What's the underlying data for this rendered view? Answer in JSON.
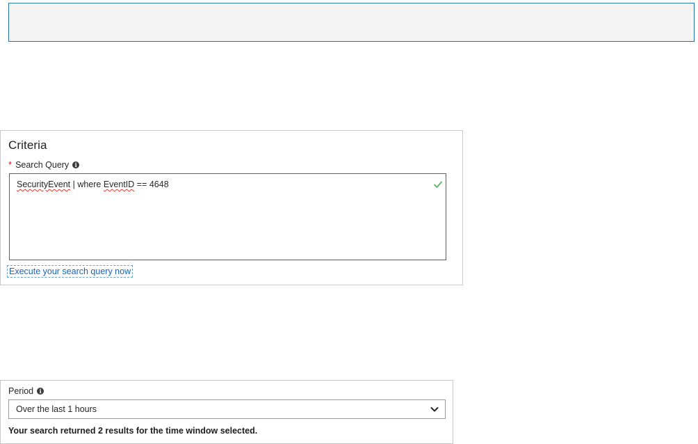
{
  "criteria": {
    "title": "Criteria",
    "query_label": "Search Query",
    "required_marker": "*",
    "query_parts": {
      "word1": "SecurityEvent",
      "middle": " | where ",
      "word2": "EventID",
      "tail": " == 4648"
    },
    "execute_link": "Execute your search query now"
  },
  "period": {
    "label": "Period",
    "selected_value": "Over the last 1 hours",
    "result_message": "Your search returned 2 results for the time window selected."
  },
  "icons": {
    "info": "info-icon",
    "valid": "checkmark-icon",
    "dropdown": "chevron-down-icon"
  },
  "colors": {
    "required_star": "#e81123",
    "query_border": "#8a3d8e",
    "link": "#1565c0",
    "check": "#5cb85c"
  }
}
